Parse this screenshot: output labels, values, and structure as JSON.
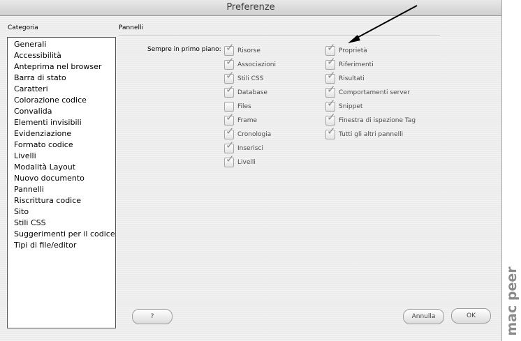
{
  "window": {
    "title": "Preferenze"
  },
  "category": {
    "label": "Categoria",
    "items": [
      "Generali",
      "Accessibilità",
      "Anteprima nel browser",
      "Barra di stato",
      "Caratteri",
      "Colorazione codice",
      "Convalida",
      "Elementi invisibili",
      "Evidenziazione",
      "Formato codice",
      "Livelli",
      "Modalità Layout",
      "Nuovo documento",
      "Pannelli",
      "Riscrittura codice",
      "Sito",
      "Stili CSS",
      "Suggerimenti per il codice",
      "Tipi di file/editor"
    ]
  },
  "panel": {
    "title": "Pannelli",
    "always_on_top_label": "Sempre in primo piano:",
    "left_column": [
      {
        "label": "Risorse",
        "checked": true
      },
      {
        "label": "Associazioni",
        "checked": true
      },
      {
        "label": "Stili CSS",
        "checked": true
      },
      {
        "label": "Database",
        "checked": true
      },
      {
        "label": "Files",
        "checked": false
      },
      {
        "label": "Frame",
        "checked": true
      },
      {
        "label": "Cronologia",
        "checked": true
      },
      {
        "label": "Inserisci",
        "checked": true
      },
      {
        "label": "Livelli",
        "checked": true
      }
    ],
    "right_column": [
      {
        "label": "Proprietà",
        "checked": true
      },
      {
        "label": "Riferimenti",
        "checked": true
      },
      {
        "label": "Risultati",
        "checked": true
      },
      {
        "label": "Comportamenti server",
        "checked": true
      },
      {
        "label": "Snippet",
        "checked": true
      },
      {
        "label": "Finestra di ispezione Tag",
        "checked": true
      },
      {
        "label": "Tutti gli altri pannelli",
        "checked": true
      }
    ]
  },
  "buttons": {
    "help": "?",
    "cancel": "Annulla",
    "ok": "OK"
  },
  "watermark": "mac peer",
  "colors": {
    "window_bg": "#ececec",
    "checkmark": "#8e8e8e",
    "watermark": "#8a8a8a"
  }
}
